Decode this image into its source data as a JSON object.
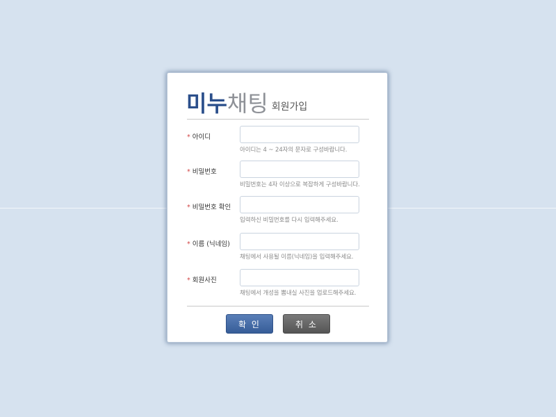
{
  "dialog": {
    "brand_part1": "미누",
    "brand_part2": "채팅",
    "subtitle": "회원가입"
  },
  "fields": [
    {
      "label": "아이디",
      "help": "아이디는 4 ~ 24자의 문자로 구성바랍니다.",
      "value": "",
      "placeholder": ""
    },
    {
      "label": "비밀번호",
      "help": "비밀번호는 4자 이상으로 복잡하게 구성바랍니다.",
      "value": "",
      "placeholder": ""
    },
    {
      "label": "비밀번호 확인",
      "help": "입력하신 비밀번호를 다시 입력해주세요.",
      "value": "",
      "placeholder": ""
    },
    {
      "label": "이름 (닉네임)",
      "help": "채팅에서 사용될 이름(닉네임)을 입력해주세요.",
      "value": "",
      "placeholder": ""
    },
    {
      "label": "회원사진",
      "help": "채팅에서 개성을 뽐내실 사진을 업로드해주세요.",
      "value": "",
      "placeholder": ""
    }
  ],
  "buttons": {
    "ok_label": "확 인",
    "cancel_label": "취 소"
  },
  "colors": {
    "background": "#d6e2ef",
    "brand": "#2b4f8b",
    "required_star": "#d24545",
    "ok_button": "#4a6fa8",
    "cancel_button": "#666666"
  },
  "required_marker": "*"
}
